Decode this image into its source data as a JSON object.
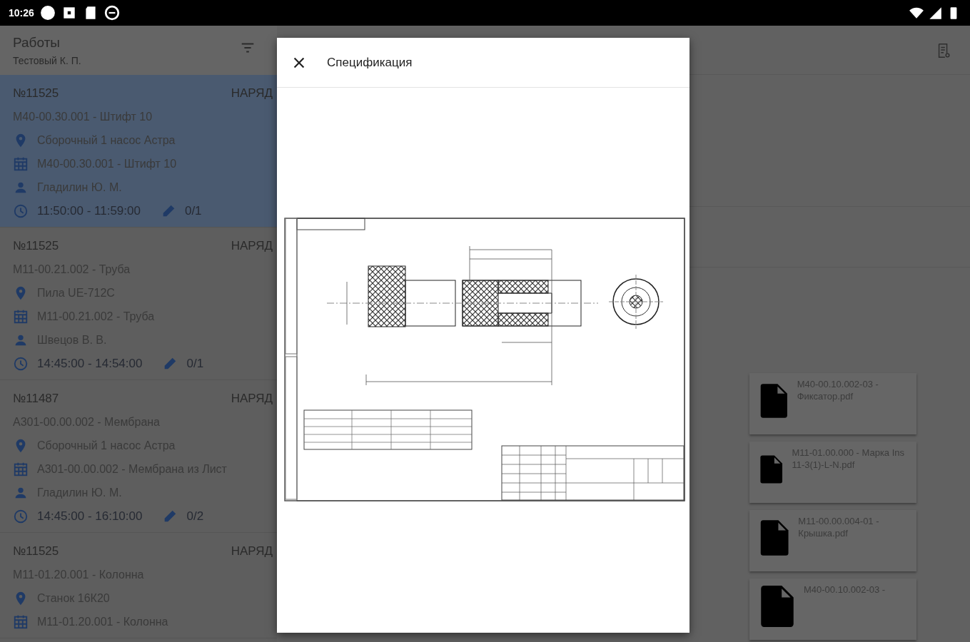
{
  "status_bar": {
    "time": "10:26"
  },
  "header": {
    "title": "Работы",
    "subtitle": "Тестовый К. П."
  },
  "jobs": [
    {
      "number": "№11525",
      "type": "НАРЯД",
      "part": "М40-00.30.001 - Штифт 10",
      "location": "Сборочный 1 насос Астра",
      "spec": "М40-00.30.001 - Штифт 10",
      "worker": "Гладилин Ю. М.",
      "time": "11:50:00 - 11:59:00",
      "progress": "0/1",
      "selected": true
    },
    {
      "number": "№11525",
      "type": "НАРЯД",
      "part": "М11-00.21.002 - Труба",
      "location": "Пила UE-712C",
      "spec": "М11-00.21.002 - Труба",
      "worker": "Швецов В. В.",
      "time": "14:45:00 - 14:54:00",
      "progress": "0/1",
      "selected": false
    },
    {
      "number": "№11487",
      "type": "НАРЯД",
      "part": "А301-00.00.002 - Мембрана",
      "location": "Сборочный 1 насос Астра",
      "spec": "А301-00.00.002 - Мембрана из Лист",
      "worker": "Гладилин Ю. М.",
      "time": "14:45:00 - 16:10:00",
      "progress": "0/2",
      "selected": false
    },
    {
      "number": "№11525",
      "type": "НАРЯД",
      "part": "М11-01.20.001 - Колонна",
      "location": "Станок 16К20",
      "spec": "М11-01.20.001 - Колонна",
      "selected": false
    }
  ],
  "files": [
    {
      "name": "М40-00.10.002-03 - Фиксатор.pdf"
    },
    {
      "name": "М11-01.00.000 - Марка Ins 11-3(1)-L-N.pdf"
    },
    {
      "name": "М11-00.00.004-01 - Крышка.pdf"
    },
    {
      "name": "М40-00.10.002-03 -"
    }
  ],
  "dialog": {
    "title": "Спецификация"
  }
}
